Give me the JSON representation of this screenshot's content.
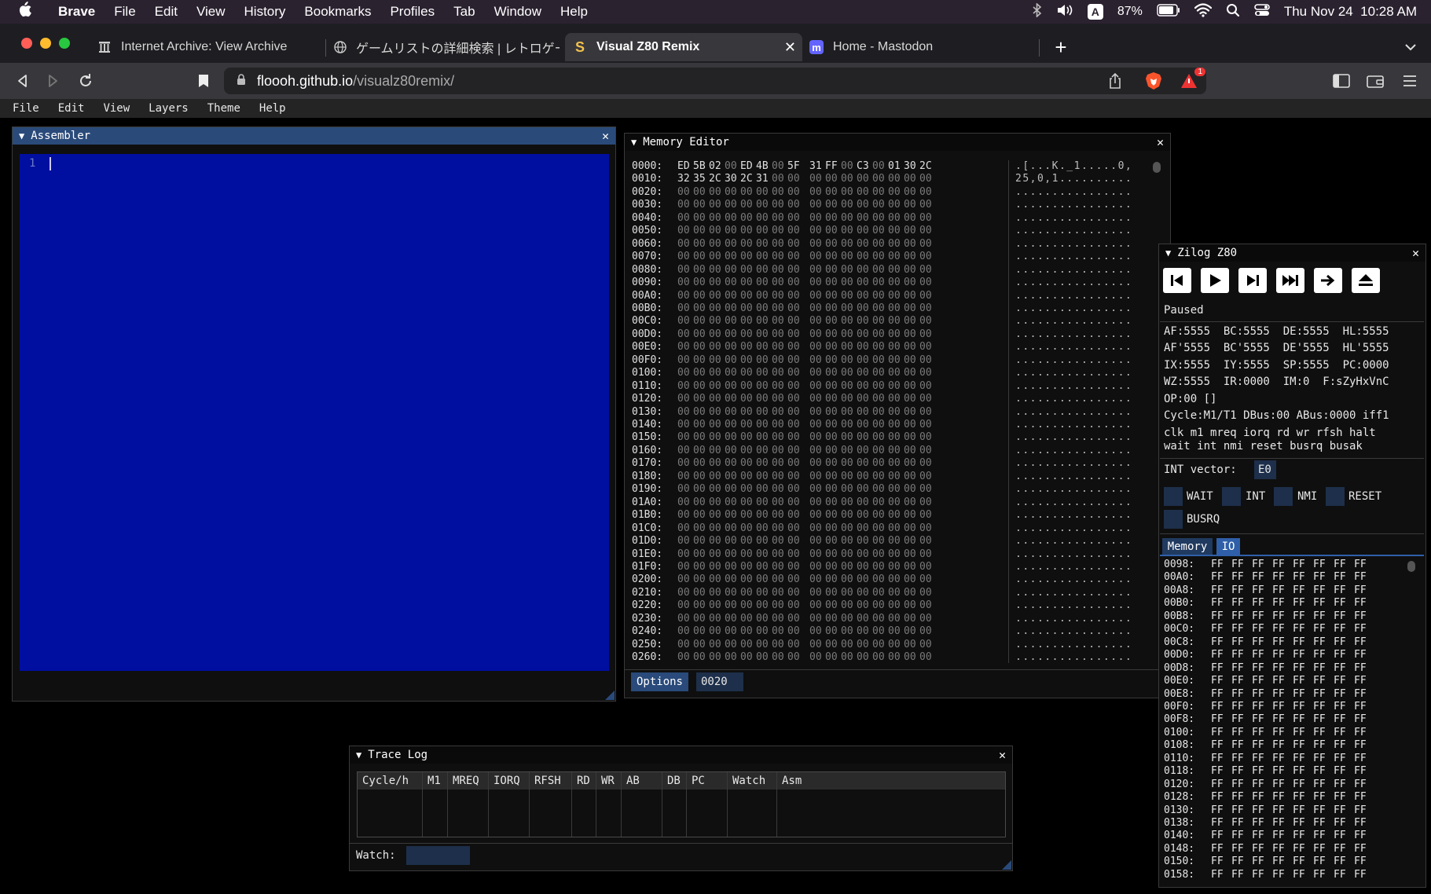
{
  "macos_menubar": {
    "app_name": "Brave",
    "items": [
      "File",
      "Edit",
      "View",
      "History",
      "Bookmarks",
      "Profiles",
      "Tab",
      "Window",
      "Help"
    ],
    "battery": "87%",
    "datetime": "Thu Nov 24  10:28 AM"
  },
  "tabs": [
    {
      "title": "Internet Archive: View Archive",
      "icon": "archive-icon"
    },
    {
      "title": "ゲームリストの詳細検索 | レトロゲーム(",
      "icon": "globe-icon"
    },
    {
      "title": "Visual Z80 Remix",
      "icon": "visual-z80-icon",
      "active": true
    },
    {
      "title": "Home - Mastodon",
      "icon": "mastodon-icon"
    }
  ],
  "address_bar": {
    "host": "floooh.github.io",
    "path": "/visualz80remix/",
    "brave_badge": "1"
  },
  "app_menu": [
    "File",
    "Edit",
    "View",
    "Layers",
    "Theme",
    "Help"
  ],
  "assembler": {
    "title": "Assembler",
    "line_number": "1"
  },
  "memory_editor": {
    "title": "Memory Editor",
    "options_label": "Options",
    "address_value": "0020",
    "row0": {
      "addr": "0000:",
      "bytes": [
        "ED",
        "5B",
        "02",
        "00",
        "ED",
        "4B",
        "00",
        "5F",
        "31",
        "FF",
        "00",
        "C3",
        "00",
        "01",
        "30",
        "2C"
      ],
      "ascii": ".[...K._1.....0,"
    },
    "row1": {
      "addr": "0010:",
      "bytes": [
        "32",
        "35",
        "2C",
        "30",
        "2C",
        "31",
        "00",
        "00",
        "00",
        "00",
        "00",
        "00",
        "00",
        "00",
        "00",
        "00"
      ],
      "ascii": "25,0,1.........."
    },
    "zero_addrs": [
      "0020:",
      "0030:",
      "0040:",
      "0050:",
      "0060:",
      "0070:",
      "0080:",
      "0090:",
      "00A0:",
      "00B0:",
      "00C0:",
      "00D0:",
      "00E0:",
      "00F0:",
      "0100:",
      "0110:",
      "0120:",
      "0130:",
      "0140:",
      "0150:",
      "0160:",
      "0170:",
      "0180:",
      "0190:",
      "01A0:",
      "01B0:",
      "01C0:",
      "01D0:",
      "01E0:",
      "01F0:",
      "0200:",
      "0210:",
      "0220:",
      "0230:",
      "0240:",
      "0250:",
      "0260:"
    ],
    "zero_byte": "00",
    "zero_ascii": "................"
  },
  "z80": {
    "title": "Zilog Z80",
    "controls": [
      "step-back-icon",
      "play-icon",
      "step-forward-icon",
      "fast-forward-icon",
      "step-over-icon",
      "eject-icon"
    ],
    "status": "Paused",
    "reg_line1": "AF:5555  BC:5555  DE:5555  HL:5555",
    "reg_line2": "AF'5555  BC'5555  DE'5555  HL'5555",
    "reg_line3": "IX:5555  IY:5555  SP:5555  PC:0000",
    "reg_line4": "WZ:5555  IR:0000  IM:0  F:sZyHxVnC",
    "op_line": "OP:00 []",
    "cycle_line": "Cycle:M1/T1 DBus:00 ABus:0000 iff1",
    "pins_line1": "clk m1 mreq iorq rd wr rfsh halt",
    "pins_line2": "wait int nmi reset busrq busak",
    "int_vector_label": "INT vector:",
    "int_vector_value": "E0",
    "checkboxes": [
      "WAIT",
      "INT",
      "NMI",
      "RESET",
      "BUSRQ"
    ],
    "tab_memory": "Memory",
    "tab_io": "IO",
    "io_addrs": [
      "0098:",
      "00A0:",
      "00A8:",
      "00B0:",
      "00B8:",
      "00C0:",
      "00C8:",
      "00D0:",
      "00D8:",
      "00E0:",
      "00E8:",
      "00F0:",
      "00F8:",
      "0100:",
      "0108:",
      "0110:",
      "0118:",
      "0120:",
      "0128:",
      "0130:",
      "0138:",
      "0140:",
      "0148:",
      "0150:",
      "0158:"
    ],
    "io_byte": "FF"
  },
  "trace_log": {
    "title": "Trace Log",
    "columns": [
      "Cycle/h",
      "M1",
      "MREQ",
      "IORQ",
      "RFSH",
      "RD",
      "WR",
      "AB",
      "DB",
      "PC",
      "Watch",
      "Asm"
    ],
    "watch_label": "Watch:"
  }
}
